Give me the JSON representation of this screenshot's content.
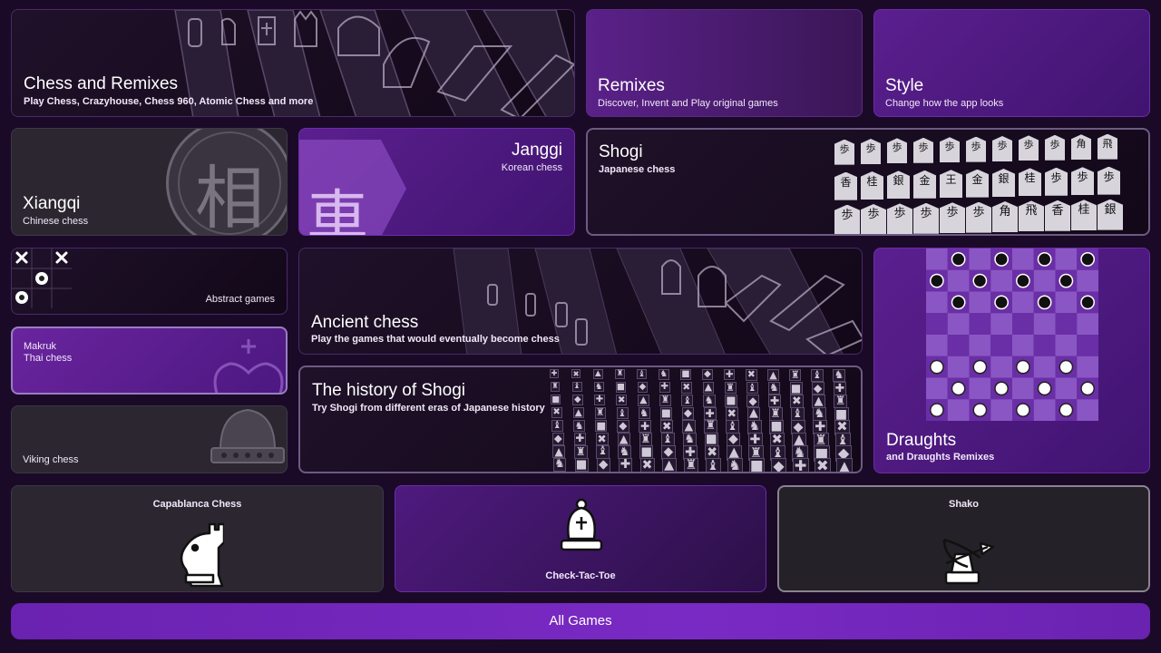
{
  "tiles": {
    "chess_remixes": {
      "title": "Chess and Remixes",
      "subtitle": "Play Chess, Crazyhouse, Chess 960, Atomic Chess and more"
    },
    "remixes": {
      "title": "Remixes",
      "subtitle": "Discover, Invent and Play original games"
    },
    "style": {
      "title": "Style",
      "subtitle": "Change how the app looks"
    },
    "xiangqi": {
      "title": "Xiangqi",
      "subtitle": "Chinese chess",
      "glyph": "相"
    },
    "janggi": {
      "title": "Janggi",
      "subtitle": "Korean chess",
      "glyph": "車"
    },
    "shogi": {
      "title": "Shogi",
      "subtitle": "Japanese chess"
    },
    "abstract": {
      "subtitle": "Abstract games"
    },
    "ancient": {
      "title": "Ancient chess",
      "subtitle": "Play the games that would eventually become chess"
    },
    "makruk": {
      "title": "Makruk",
      "subtitle": "Thai chess"
    },
    "history_shogi": {
      "title": "The history of Shogi",
      "subtitle": "Try Shogi from different eras of Japanese history"
    },
    "draughts": {
      "title": "Draughts",
      "subtitle": "and Draughts Remixes"
    },
    "viking": {
      "subtitle": "Viking chess"
    },
    "capablanca": {
      "title": "Capablanca Chess"
    },
    "check_tac_toe": {
      "title": "Check-Tac-Toe"
    },
    "shako": {
      "title": "Shako"
    }
  },
  "shogi_pieces": [
    "歩",
    "歩",
    "歩",
    "歩",
    "歩",
    "歩",
    "歩",
    "歩",
    "歩",
    "角",
    "飛",
    "香",
    "桂",
    "銀",
    "金",
    "王",
    "金",
    "銀",
    "桂"
  ],
  "all_games_label": "All Games",
  "colors": {
    "background": "#1a0a28",
    "accent": "#7a2ac4",
    "purple_tile": "#5b1f8f"
  }
}
